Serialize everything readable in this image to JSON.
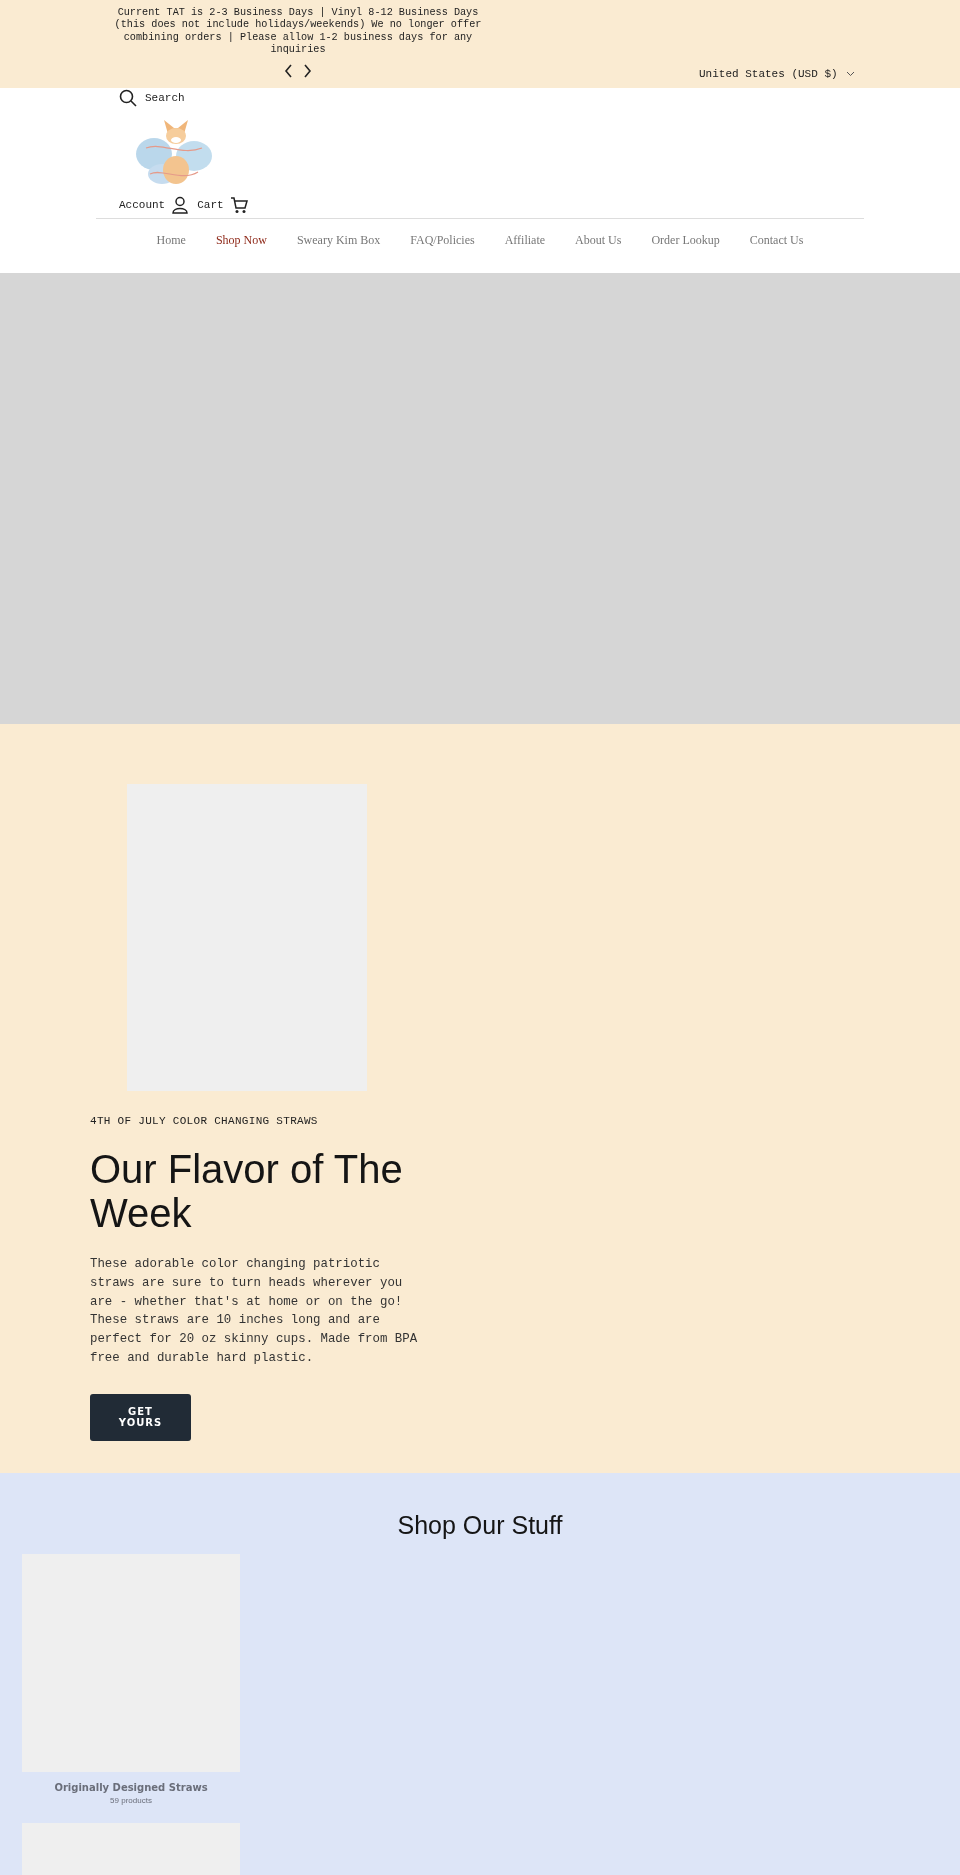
{
  "announcement": {
    "text": "Current TAT is 2-3 Business Days | Vinyl 8-12 Business Days (this does not include holidays/weekends) We no longer offer combining orders | Please allow 1-2 business days for any inquiries",
    "currency": "United States (USD $)"
  },
  "header": {
    "search": "Search",
    "account": "Account",
    "cart": "Cart"
  },
  "nav": [
    {
      "label": "Home",
      "selected": false
    },
    {
      "label": "Shop Now",
      "selected": true
    },
    {
      "label": "Sweary Kim Box",
      "selected": false
    },
    {
      "label": "FAQ/Policies",
      "selected": false
    },
    {
      "label": "Affiliate",
      "selected": false
    },
    {
      "label": "About Us",
      "selected": false
    },
    {
      "label": "Order Lookup",
      "selected": false
    },
    {
      "label": "Contact Us",
      "selected": false
    }
  ],
  "feature": {
    "eyebrow": "4TH OF JULY COLOR CHANGING STRAWS",
    "title": "Our Flavor of The Week",
    "body": "These adorable color changing patriotic straws are sure to turn heads wherever you are - whether that's at home or on the go! These straws are 10 inches long and are perfect for 20 oz skinny cups. Made from BPA free and durable hard plastic.",
    "button": "GET YOURS"
  },
  "collections": {
    "title": "Shop Our Stuff",
    "items": [
      {
        "kind": "collection",
        "title": "Originally Designed Straws",
        "count": "59 products"
      },
      {
        "kind": "picture"
      }
    ]
  }
}
